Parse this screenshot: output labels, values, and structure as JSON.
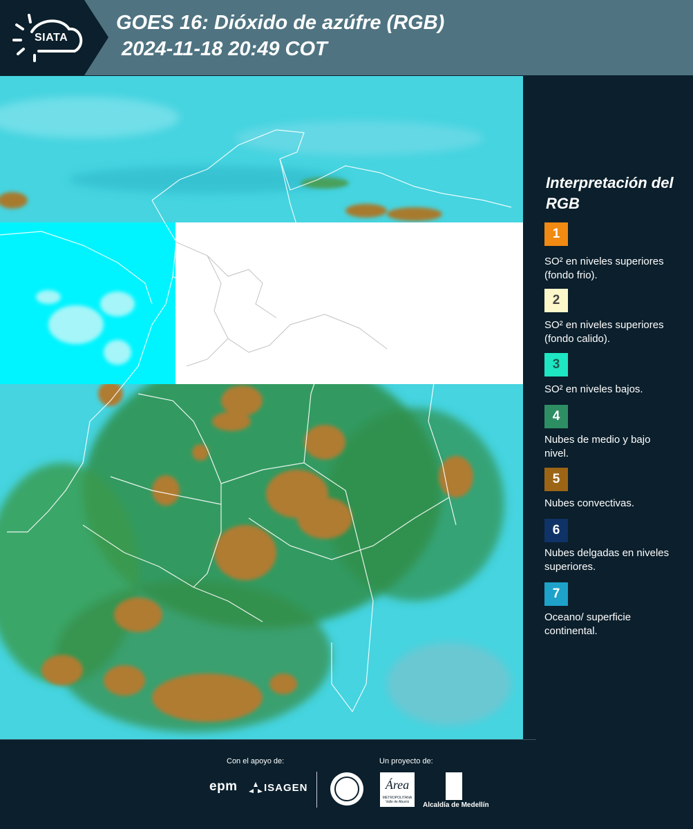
{
  "header": {
    "logo_text": "SIATA",
    "title_line1": "GOES 16: Dióxido de azúfre (RGB)",
    "title_line2": " 2024-11-18 20:49 COT"
  },
  "legend": {
    "title": "Interpretación del RGB",
    "items": [
      {
        "number": "1",
        "color": "#f08a13",
        "text": "SO² en niveles superiores (fondo frio)."
      },
      {
        "number": "2",
        "color": "#fdf8c9",
        "text": "SO² en niveles superiores (fondo calido)."
      },
      {
        "number": "3",
        "color": "#1ee6c2",
        "text": "SO² en niveles bajos."
      },
      {
        "number": "4",
        "color": "#2e8e63",
        "text": "Nubes de medio y bajo nivel."
      },
      {
        "number": "5",
        "color": "#9c6516",
        "text": "Nubes convectivas."
      },
      {
        "number": "6",
        "color": "#0f3366",
        "text": "Nubes delgadas en niveles superiores."
      },
      {
        "number": "7",
        "color": "#1ea2c9",
        "text": "Oceano/ superficie continental."
      }
    ]
  },
  "footer": {
    "support_label": "Con el apoyo de:",
    "project_label": "Un proyecto de:",
    "sponsor1": "epm",
    "sponsor2": "ISAGEN",
    "partner_area": "Área",
    "partner_area_sub": "METROPOLITANA Valle de Aburrá",
    "partner_alcaldia": "Alcaldía de Medellín"
  },
  "map": {
    "colors": {
      "background": "#3fd6e2",
      "no_data": "#ffffff",
      "no_data_cyan": "#00f4ff",
      "clouds_convective": "#b07c33",
      "clouds_mid": "#2f8f4a",
      "borders": "#ffffff"
    }
  }
}
